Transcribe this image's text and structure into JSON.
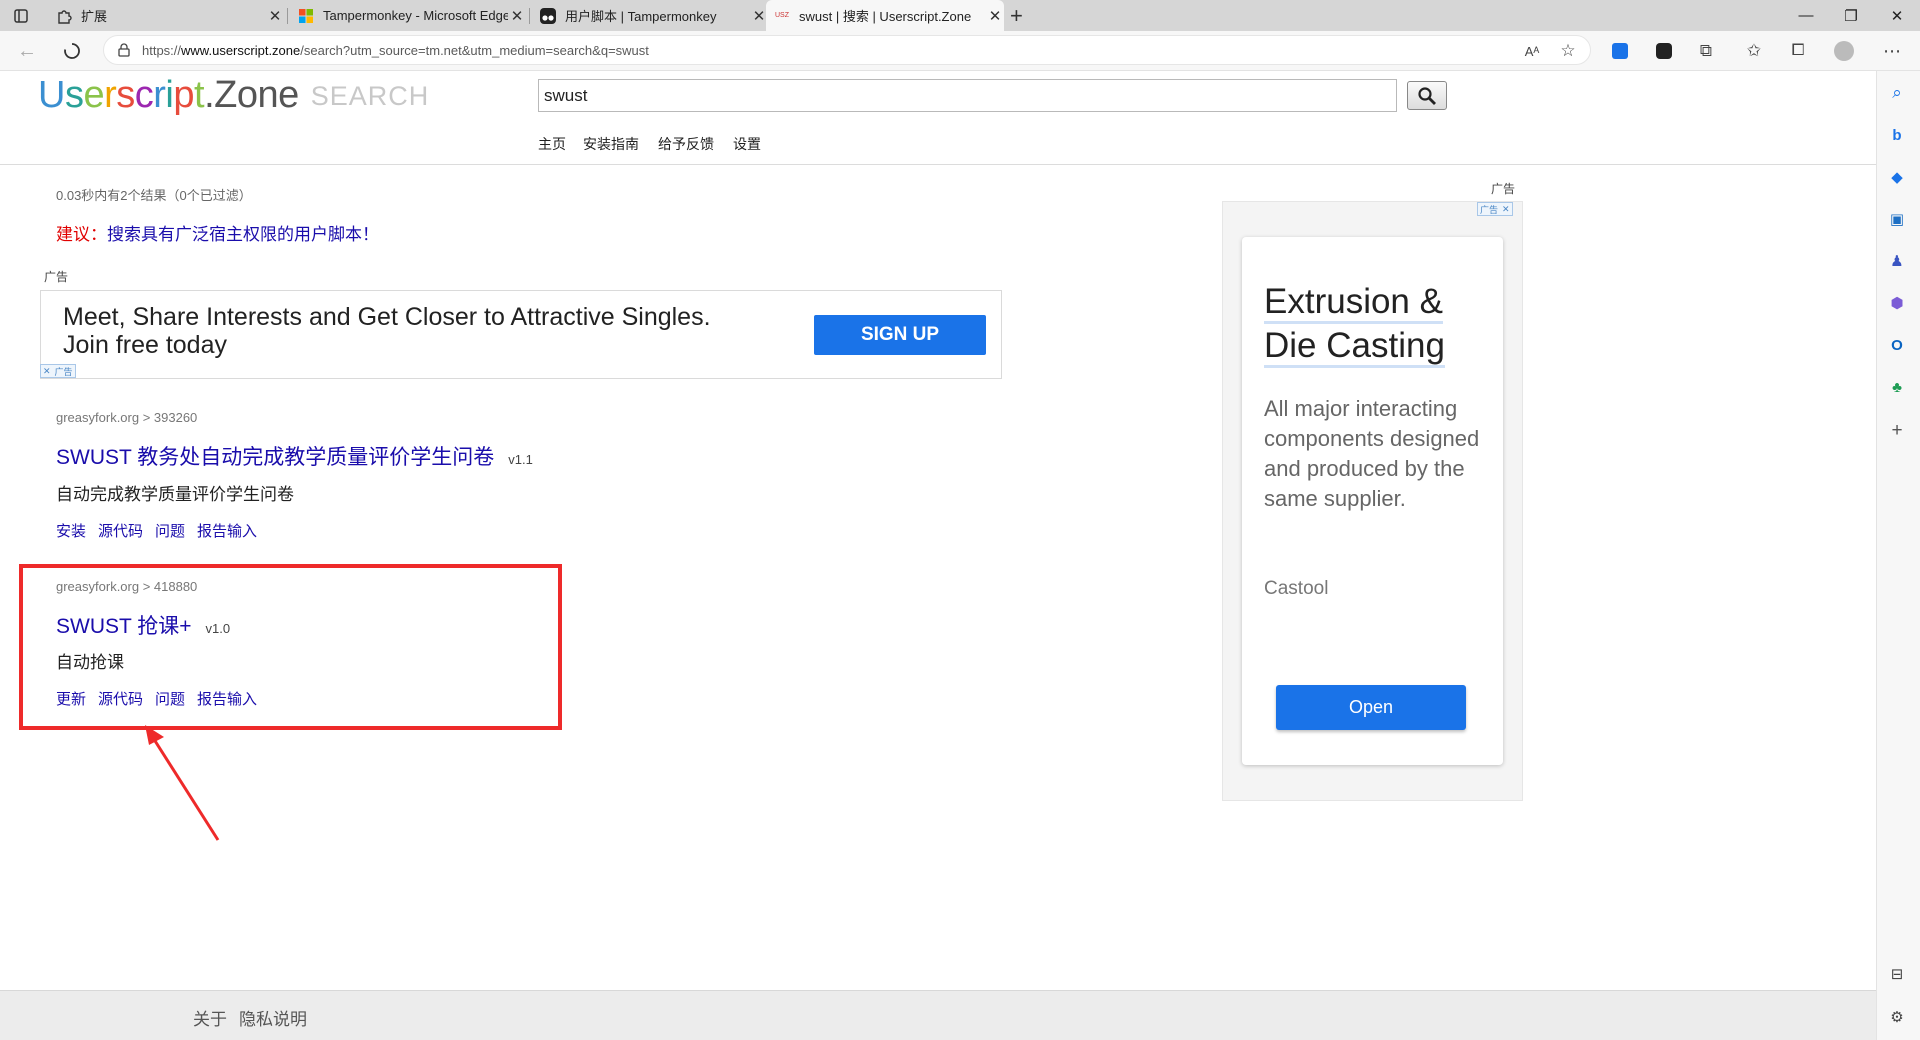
{
  "browser": {
    "tabs": [
      {
        "title": "扩展",
        "icon": "puzzle-icon"
      },
      {
        "title": "Tampermonkey - Microsoft Edge",
        "icon": "microsoft-logo-icon"
      },
      {
        "title": "用户脚本 | Tampermonkey",
        "icon": "tampermonkey-icon"
      },
      {
        "title": "swust | 搜索 | Userscript.Zone",
        "icon": "usz-icon",
        "favicon_text": "USZ"
      }
    ],
    "new_tab": "+",
    "url": {
      "prefix": "https://",
      "host": "www.userscript.zone",
      "path": "/search?utm_source=tm.net&utm_medium=search&q=swust"
    }
  },
  "site": {
    "logo_letters": [
      "U",
      "s",
      "e",
      "r",
      "s",
      "c",
      "r",
      "i",
      "p",
      "t",
      ".",
      "Z",
      "o",
      "n",
      "e"
    ],
    "logo_colors": [
      "#3b8fd1",
      "#2aa198",
      "#8bc34a",
      "#f0a400",
      "#e74c3c",
      "#9c27b0",
      "#3b8fd1",
      "#2aa198",
      "#e74c3c",
      "#8bc34a",
      "#555555",
      "#555555",
      "#555555",
      "#555555",
      "#555555"
    ],
    "logo_search": "SEARCH",
    "search_value": "swust",
    "nav": [
      "主页",
      "安装指南",
      "给予反馈",
      "设置"
    ]
  },
  "results_meta": "0.03秒内有2个结果（0个已过滤）",
  "suggestion": {
    "label": "建议：",
    "link": "搜索具有广泛宿主权限的用户脚本！"
  },
  "ad_label": "广告",
  "banner_ad": {
    "text": "Meet, Share Interests and Get Closer to Attractive Singles. Join free today",
    "button": "SIGN UP",
    "choice": "广告"
  },
  "results": [
    {
      "source": "greasyfork.org > 393260",
      "title": "SWUST 教务处自动完成教学质量评价学生问卷",
      "version": "v1.1",
      "description": "自动完成教学质量评价学生问卷",
      "links": [
        "安装",
        "源代码",
        "问题",
        "报告输入"
      ]
    },
    {
      "source": "greasyfork.org > 418880",
      "title": "SWUST 抢课+",
      "version": "v1.0",
      "description": "自动抢课",
      "links": [
        "更新",
        "源代码",
        "问题",
        "报告输入"
      ]
    }
  ],
  "side_ad": {
    "label": "广告",
    "choice": "广告",
    "title_line1": "Extrusion &",
    "title_line2": "Die Casting",
    "body": "All major interacting components designed and produced by the same supplier.",
    "brand": "Castool",
    "button": "Open"
  },
  "footer": {
    "about": "关于",
    "privacy": "隐私说明"
  },
  "colors": {
    "accent": "#1a73e8",
    "link": "#1a0dab",
    "highlight": "#ee2a2a"
  }
}
